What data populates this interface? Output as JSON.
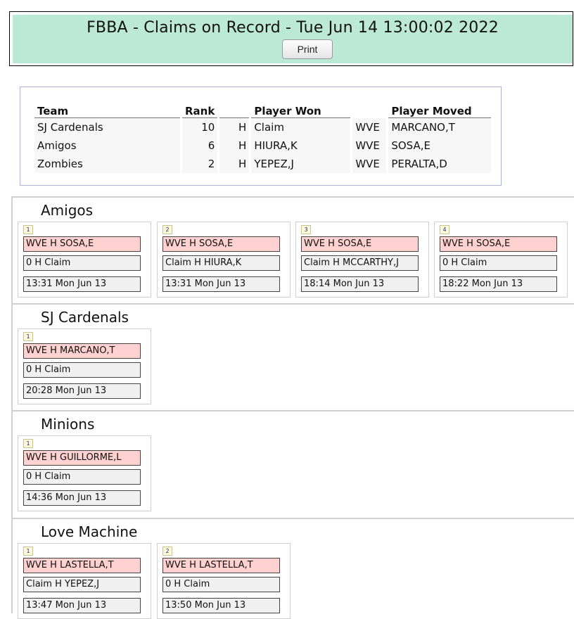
{
  "header": {
    "title": "FBBA - Claims on Record - Tue Jun 14 13:00:02 2022",
    "print_label": "Print"
  },
  "summary": {
    "headers": {
      "team": "Team",
      "rank": "Rank",
      "won": "Player Won",
      "moved": "Player Moved"
    },
    "rows": [
      {
        "team": "SJ Cardenals",
        "rank": "10",
        "h": "H",
        "won": "Claim",
        "wve": "WVE",
        "moved": "MARCANO,T"
      },
      {
        "team": "Amigos",
        "rank": "6",
        "h": "H",
        "won": "HIURA,K",
        "wve": "WVE",
        "moved": "SOSA,E"
      },
      {
        "team": "Zombies",
        "rank": "2",
        "h": "H",
        "won": "YEPEZ,J",
        "wve": "WVE",
        "moved": "PERALTA,D"
      }
    ]
  },
  "sections": [
    {
      "name": "Amigos",
      "claims": [
        {
          "num": "1",
          "moved": "WVE H SOSA,E",
          "won": "0 H Claim",
          "time": "13:31 Mon Jun 13"
        },
        {
          "num": "2",
          "moved": "WVE H SOSA,E",
          "won": "Claim H HIURA,K",
          "time": "13:31 Mon Jun 13"
        },
        {
          "num": "3",
          "moved": "WVE H SOSA,E",
          "won": "Claim H MCCARTHY,J",
          "time": "18:14 Mon Jun 13"
        },
        {
          "num": "4",
          "moved": "WVE H SOSA,E",
          "won": "0 H Claim",
          "time": "18:22 Mon Jun 13"
        }
      ]
    },
    {
      "name": "SJ Cardenals",
      "claims": [
        {
          "num": "1",
          "moved": "WVE H MARCANO,T",
          "won": "0 H Claim",
          "time": "20:28 Mon Jun 13"
        }
      ]
    },
    {
      "name": "Minions",
      "claims": [
        {
          "num": "1",
          "moved": "WVE H GUILLORME,L",
          "won": "0 H Claim",
          "time": "14:36 Mon Jun 13"
        }
      ]
    },
    {
      "name": "Love Machine",
      "claims": [
        {
          "num": "1",
          "moved": "WVE H LASTELLA,T",
          "won": "Claim H YEPEZ,J",
          "time": "13:47 Mon Jun 13"
        },
        {
          "num": "2",
          "moved": "WVE H LASTELLA,T",
          "won": "0 H Claim",
          "time": "13:50 Mon Jun 13"
        }
      ]
    }
  ]
}
